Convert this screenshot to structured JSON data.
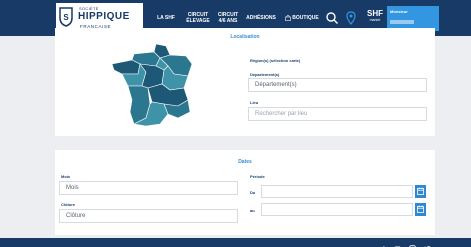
{
  "brand": {
    "small": "SOCIÉTÉ",
    "main": "HIPPIQUE",
    "sub": "FRANÇAISE"
  },
  "nav": {
    "la_shf": "LA SHF",
    "circuit_elevage_line1": "CIRCUIT",
    "circuit_elevage_line2": "ÉLEVAGE",
    "circuit_46_line1": "CIRCUIT",
    "circuit_46_line2": "4/6 ANS",
    "adhesions": "ADHÉSIONS",
    "boutique": "BOUTIQUE",
    "shf_big": "SHF",
    "shf_small": "market"
  },
  "account": {
    "greeting": "Monsieur"
  },
  "localisation": {
    "title": "Localisation",
    "region_label": "Région(s) (sélection carte)",
    "departement_label": "Département(s)",
    "departement_placeholder": "Département(s)",
    "lieu_label": "Lieu",
    "lieu_placeholder": "Rechercher par lieu"
  },
  "dates": {
    "title": "Dates",
    "mois_label": "Mois",
    "mois_value": "Mois",
    "cloture_label": "Clôture",
    "cloture_value": "Clôture",
    "periode_label": "Période",
    "du_label": "Du",
    "au_label": "au"
  },
  "map_colors": {
    "dark": "#1d5876",
    "mid": "#2b7790",
    "light": "#3f93a8"
  },
  "icons": [
    "shield-icon",
    "search-icon",
    "location-icon",
    "calendar-icon",
    "facebook-icon",
    "youtube-icon",
    "instagram-icon",
    "twitter-icon"
  ]
}
